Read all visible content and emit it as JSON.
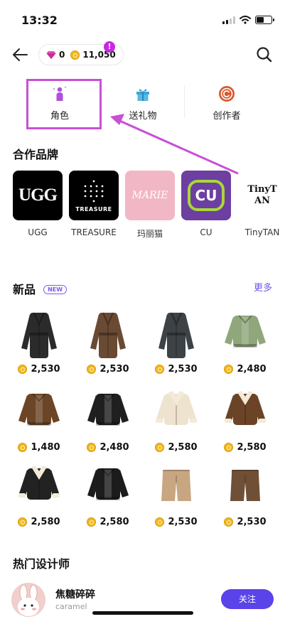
{
  "status_bar": {
    "time": "13:32"
  },
  "top_bar": {
    "gems": "0",
    "coins": "11,050",
    "alert_badge": "!"
  },
  "category_tabs": [
    {
      "label": "角色",
      "icon": "character-icon",
      "color": "#b04fe0"
    },
    {
      "label": "送礼物",
      "icon": "gift-icon",
      "color": "#3aa5d8"
    },
    {
      "label": "创作者",
      "icon": "creator-icon",
      "color": "#d9572c"
    }
  ],
  "brands_section": {
    "title": "合作品牌",
    "items": [
      {
        "name": "UGG",
        "logo_text": "UGG"
      },
      {
        "name": "TREASURE",
        "logo_text": "TREASURE"
      },
      {
        "name": "玛丽猫",
        "logo_text": "MARIE"
      },
      {
        "name": "CU",
        "logo_text": "CU"
      },
      {
        "name": "TinyTAN",
        "logo_text": "TinyTAN"
      }
    ]
  },
  "new_section": {
    "title": "新品",
    "badge": "NEW",
    "more": "更多",
    "products": [
      {
        "price": "2,530",
        "item": "long-coat",
        "color": "#2b2b2b"
      },
      {
        "price": "2,530",
        "item": "long-coat",
        "color": "#6a4a33"
      },
      {
        "price": "2,530",
        "item": "long-coat",
        "color": "#3d4246"
      },
      {
        "price": "2,480",
        "item": "jacket",
        "color": "#8fa77a"
      },
      {
        "price": "1,480",
        "item": "jacket",
        "color": "#6b4526"
      },
      {
        "price": "2,480",
        "item": "jacket",
        "color": "#1f1f1f"
      },
      {
        "price": "2,580",
        "item": "shearling-jacket",
        "color": "#ede3cf"
      },
      {
        "price": "2,580",
        "item": "shearling-jacket",
        "color": "#6b4326"
      },
      {
        "price": "2,580",
        "item": "shearling-jacket",
        "color": "#222222"
      },
      {
        "price": "2,580",
        "item": "jacket",
        "color": "#1c1c1c"
      },
      {
        "price": "2,530",
        "item": "shorts",
        "color": "#c8a682"
      },
      {
        "price": "2,530",
        "item": "shorts",
        "color": "#6f5036"
      }
    ]
  },
  "designers_section": {
    "title": "热门设计师",
    "designer": {
      "name": "焦糖碎碎",
      "handle": "caramel",
      "follow": "关注"
    }
  }
}
